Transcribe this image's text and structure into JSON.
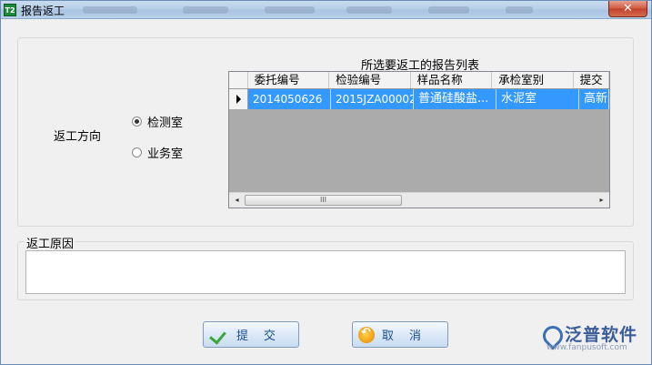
{
  "window": {
    "title": "报告返工",
    "app_icon": "T2",
    "close_glyph": "✕"
  },
  "direction": {
    "label": "返工方向",
    "options": [
      {
        "label": "检测室",
        "selected": true
      },
      {
        "label": "业务室",
        "selected": false
      }
    ]
  },
  "report_list": {
    "caption": "所选要返工的报告列表",
    "columns": [
      "委托编号",
      "检验编号",
      "样品名称",
      "承检室别",
      "提交"
    ],
    "rows": [
      {
        "cells": [
          "2014050626",
          "2015JZA00002",
          "普通硅酸盐...",
          "水泥室",
          "高新"
        ],
        "selected": true
      }
    ],
    "scroll_left": "◂",
    "scroll_right": "▸",
    "scroll_thumb": "III"
  },
  "reason": {
    "label": "返工原因",
    "value": ""
  },
  "buttons": {
    "submit": "提　交",
    "cancel": "取　消"
  },
  "brand": {
    "name": "泛普软件",
    "url": "www.fanpusoft.com"
  },
  "colors": {
    "selection": "#3399ff",
    "titlebar": "#b7cee8",
    "close": "#c4402a"
  }
}
